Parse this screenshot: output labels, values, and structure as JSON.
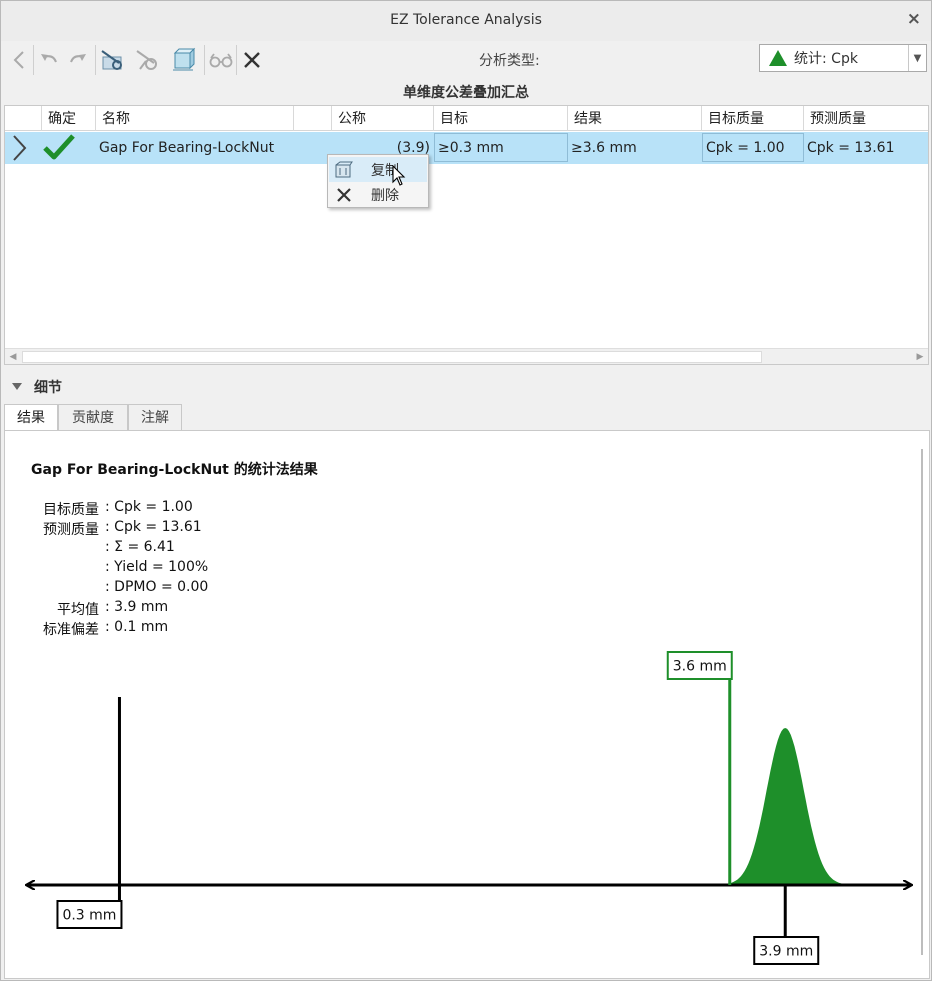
{
  "window": {
    "title": "EZ Tolerance Analysis",
    "close_glyph": "×"
  },
  "toolbar": {
    "buttons": [
      {
        "name": "back-icon",
        "glyph": "❮"
      },
      {
        "name": "undo-icon",
        "glyph": "↶"
      },
      {
        "name": "redo-icon",
        "glyph": "↷"
      },
      {
        "name": "add-stack-icon",
        "glyph": "⚙"
      },
      {
        "name": "edit-stack-icon",
        "glyph": "⚙"
      },
      {
        "name": "cube-icon",
        "glyph": "▣"
      },
      {
        "name": "glasses-icon",
        "glyph": "∞"
      },
      {
        "name": "delete-icon",
        "glyph": "✕"
      }
    ],
    "analysis_type_label": "分析类型:",
    "analysis_type_value": "统计: Cpk",
    "analysis_type_icon": "green-triangle-icon"
  },
  "summary": {
    "title": "单维度公差叠加汇总",
    "columns": [
      "确定",
      "名称",
      "",
      "公称",
      "目标",
      "结果",
      "目标质量",
      "预测质量"
    ],
    "rows": [
      {
        "status_icon": "checkmark-icon",
        "name": "Gap For Bearing-LockNut",
        "nominal": "(3.9)",
        "target": "≥0.3 mm",
        "result": "≥3.6 mm",
        "target_quality": "Cpk = 1.00",
        "predicted_quality": "Cpk = 13.61"
      }
    ]
  },
  "context_menu": {
    "items": [
      {
        "label": "复制",
        "icon": "copy-icon"
      },
      {
        "label": "删除",
        "icon": "delete-icon"
      }
    ]
  },
  "details": {
    "label": "细节",
    "tabs": [
      "结果",
      "贡献度",
      "注解"
    ],
    "active_tab": 0,
    "result_title": "Gap For Bearing-LockNut 的统计法结果",
    "stats": [
      {
        "key": "目标质量",
        "value": ": Cpk = 1.00"
      },
      {
        "key": "预测质量",
        "value": ": Cpk = 13.61"
      },
      {
        "key": "",
        "value": ": Σ = 6.41"
      },
      {
        "key": "",
        "value": ": Yield = 100%"
      },
      {
        "key": "",
        "value": ": DPMO = 0.00"
      },
      {
        "key": "平均值",
        "value": ": 3.9 mm"
      },
      {
        "key": "标准偏差",
        "value": ": 0.1 mm"
      }
    ]
  },
  "colors": {
    "accent_green": "#1e8f2a",
    "selection_blue": "#b8e2f8",
    "axis_black": "#000000"
  },
  "chart_data": {
    "type": "area",
    "title": "",
    "distribution": "normal",
    "mean": 3.9,
    "std_dev": 0.1,
    "xlim": [
      -0.2,
      4.58
    ],
    "markers": [
      {
        "value": 0.3,
        "label": "0.3 mm",
        "kind": "target-limit"
      },
      {
        "value": 3.6,
        "label": "3.6 mm",
        "kind": "result-limit"
      },
      {
        "value": 3.9,
        "label": "3.9 mm",
        "kind": "mean"
      }
    ]
  }
}
